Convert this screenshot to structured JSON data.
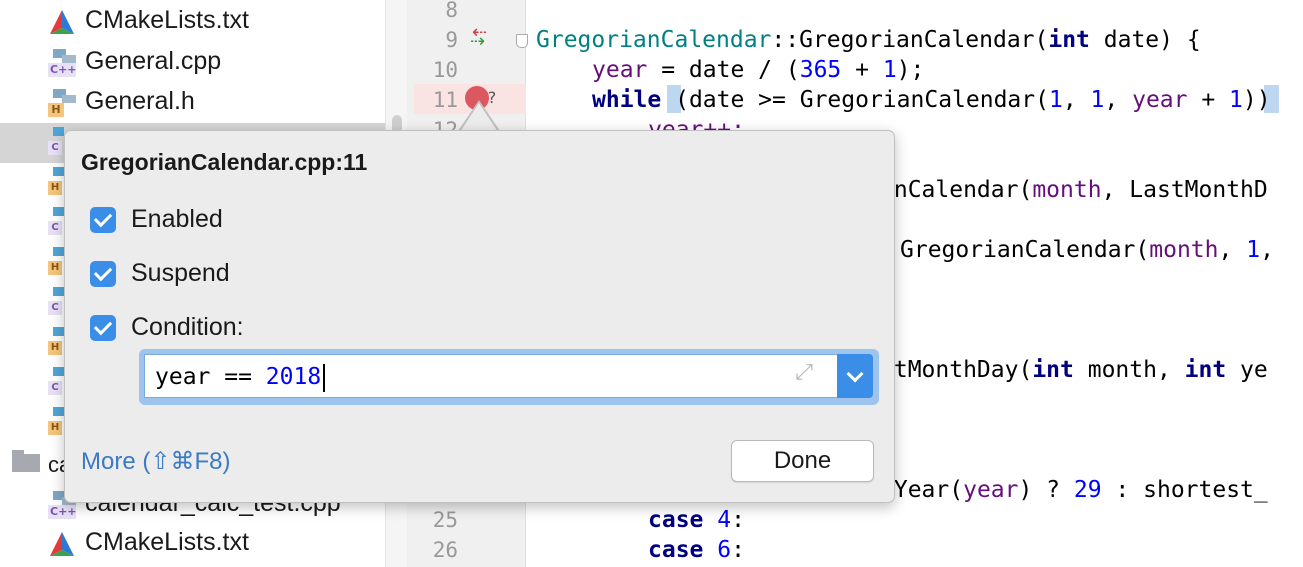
{
  "project_tree": {
    "items": [
      {
        "name": "CMakeLists.txt",
        "type": "cmake"
      },
      {
        "name": "General.cpp",
        "type": "cpp"
      },
      {
        "name": "General.h",
        "type": "h"
      }
    ],
    "partial_folder": "ca",
    "bottom_items": [
      {
        "name": "calendar_calc_test.cpp",
        "type": "cpp"
      },
      {
        "name": "CMakeLists.txt",
        "type": "cmake"
      }
    ],
    "icon_tags": {
      "cpp": "C++",
      "h": "H",
      "cpp_short": "C",
      "h_short": "H"
    }
  },
  "editor": {
    "line_numbers": {
      "l8": "8",
      "l9": "9",
      "l10": "10",
      "l11": "11",
      "l12": "12",
      "l25": "25",
      "l26": "26"
    },
    "code": {
      "line9": {
        "cls": "GregorianCalendar",
        "sep": "::",
        "fn": "GregorianCalendar(",
        "kw": "int",
        "rest": " date) {"
      },
      "line10": {
        "var": "year",
        "a": " = date / (",
        "n1": "365",
        "b": " + ",
        "n2": "1",
        "c": ");"
      },
      "line11": {
        "kw": "while",
        "a": " (date >= GregorianCalendar(",
        "n1": "1",
        "b": ", ",
        "n2": "1",
        "c": ", ",
        "var": "year",
        "d": " + ",
        "n3": "1",
        "e": "))"
      },
      "line12": "year++;",
      "line_a": {
        "pre": "anCalendar(",
        "var": "month",
        "rest": ", LastMonthD"
      },
      "line_b": {
        "pre": "GregorianCalendar(",
        "var": "month",
        "rest": ", ",
        "n": "1",
        "end": ","
      },
      "line_c": {
        "pre": "stMonthDay(",
        "kw1": "int",
        "mid": " month, ",
        "kw2": "int",
        "rest": " ye"
      },
      "line_d": {
        "pre": "pYear(",
        "var": "year",
        "a": ") ? ",
        "n": "29",
        "rest": " : shortest_"
      },
      "line25": {
        "kw": "case",
        "n": "4",
        "rest": ":"
      },
      "line26": {
        "kw": "case",
        "n": "6",
        "rest": ":"
      }
    },
    "breakpoint_suffix": "?"
  },
  "breakpoint_popup": {
    "title": "GregorianCalendar.cpp:11",
    "options": [
      {
        "label": "Enabled",
        "checked": true
      },
      {
        "label": "Suspend",
        "checked": true
      },
      {
        "label": "Condition:",
        "checked": true
      }
    ],
    "condition": {
      "prefix": "year == ",
      "number": "2018"
    },
    "expand_glyph": "⤢",
    "more_link": "More (⇧⌘F8)",
    "done_label": "Done"
  },
  "colors": {
    "accent": "#3a8ee8",
    "breakpoint": "#db5860",
    "breakpoint_line": "#fae3e3",
    "link": "#3c7ac4"
  }
}
